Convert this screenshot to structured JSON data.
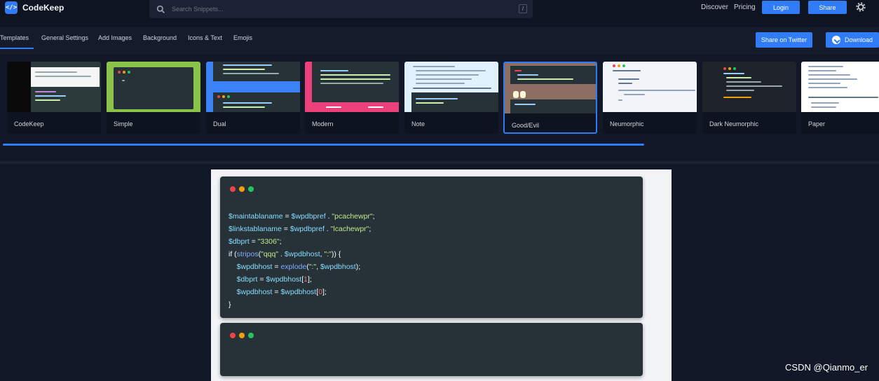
{
  "brand": {
    "name": "CodeKeep",
    "accent": "#2f7cf6"
  },
  "search": {
    "placeholder": "Search Snippets...",
    "shortcut": "/"
  },
  "nav": {
    "discover": "Discover",
    "pricing": "Pricing",
    "login": "Login",
    "share": "Share"
  },
  "tabs": [
    "Templates",
    "General Settings",
    "Add Images",
    "Background",
    "Icons & Text",
    "Emojis"
  ],
  "actions": {
    "share_twitter": "Share on Twitter",
    "download": "Download"
  },
  "templates": [
    "CodeKeep",
    "Simple",
    "Dual",
    "Modern",
    "Note",
    "Good/Evil",
    "Neumorphic",
    "Dark Neumorphic",
    "Paper"
  ],
  "selected_template": "Good/Evil",
  "editor": {
    "lines": [
      [
        "v:$maintablaname",
        "t: = ",
        "v:$wpdbpref",
        "t: . ",
        "s:\"pcachewpr\"",
        "t:;"
      ],
      [
        "v:$linkstablaname",
        "t: = ",
        "v:$wpdbpref",
        "t: . ",
        "s:\"lcachewpr\"",
        "t:;"
      ],
      [
        "v:$dbprt",
        "t: = ",
        "s:\"3306\"",
        "t:;"
      ],
      [
        "t:if (",
        "f:stripos",
        "t:(",
        "s:\"qqq\"",
        "t: . ",
        "v:$wpdbhost",
        "t:, ",
        "s:\":\"",
        "t:)) {"
      ],
      [
        "t:    ",
        "v:$wpdbhost",
        "t: = ",
        "f:explode",
        "t:(",
        "s:\":\"",
        "t:, ",
        "v:$wpdbhost",
        "t:);"
      ],
      [
        "t:    ",
        "v:$dbprt",
        "t: = ",
        "v:$wpdbhost",
        "t:[",
        "p:1",
        "t:];"
      ],
      [
        "t:    ",
        "v:$wpdbhost",
        "t: = ",
        "v:$wpdbhost",
        "t:[",
        "p:0",
        "t:];"
      ],
      [
        "t:}"
      ]
    ]
  },
  "watermark": "CSDN @Qianmo_er"
}
